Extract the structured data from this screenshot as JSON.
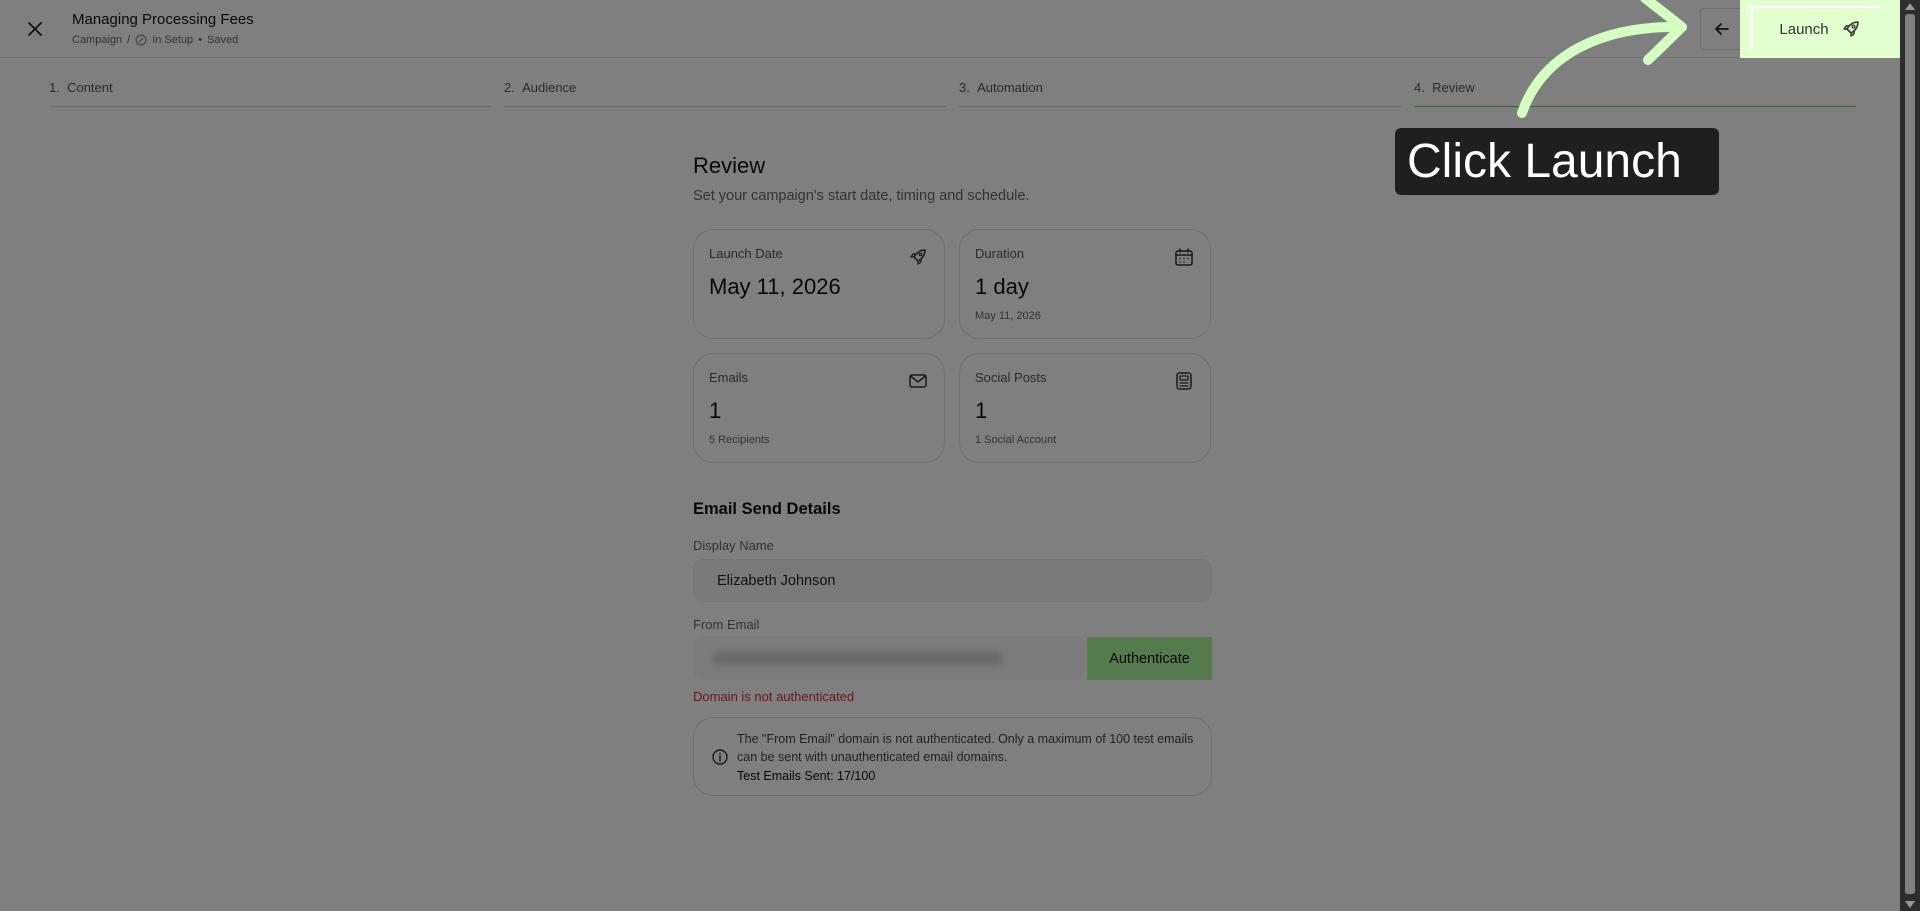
{
  "header": {
    "title": "Managing Processing Fees",
    "breadcrumb_campaign": "Campaign",
    "breadcrumb_separator": "/",
    "status": "In Setup",
    "status_dot": "•",
    "saved": "Saved",
    "launch_label": "Launch"
  },
  "steps": [
    {
      "num": "1.",
      "label": "Content"
    },
    {
      "num": "2.",
      "label": "Audience"
    },
    {
      "num": "3.",
      "label": "Automation"
    },
    {
      "num": "4.",
      "label": "Review"
    }
  ],
  "review": {
    "title": "Review",
    "description": "Set your campaign's start date, timing and schedule."
  },
  "cards": {
    "launch_date": {
      "label": "Launch Date",
      "value": "May 11, 2026",
      "sub": ""
    },
    "duration": {
      "label": "Duration",
      "value": "1 day",
      "sub": "May 11, 2026"
    },
    "emails": {
      "label": "Emails",
      "value": "1",
      "sub": "5 Recipients"
    },
    "social_posts": {
      "label": "Social Posts",
      "value": "1",
      "sub": "1 Social Account"
    }
  },
  "email_details": {
    "title": "Email Send Details",
    "display_name_label": "Display Name",
    "display_name_value": "Elizabeth Johnson",
    "from_email_label": "From Email",
    "authenticate_label": "Authenticate",
    "error": "Domain is not authenticated",
    "info_text": "The \"From Email\" domain is not authenticated. Only a maximum of 100 test emails can be sent with unauthenticated email domains.",
    "test_emails": "Test Emails Sent: 17/100"
  },
  "tooltip": {
    "text": "Click Launch"
  },
  "colors": {
    "accent_green": "#a8f59b",
    "launch_highlight": "#e2ffcf",
    "error_red": "#d93030",
    "step_active": "#6fc96f",
    "tooltip_bg": "#1f1f1f",
    "arrow": "#d5ffc2"
  },
  "icons": {
    "close": "close-icon",
    "back": "arrow-left-icon",
    "launch": "rocket-icon",
    "calendar": "calendar-icon",
    "mail": "mail-icon",
    "social": "news-icon",
    "info": "info-icon",
    "status": "pencil-circle-icon"
  }
}
